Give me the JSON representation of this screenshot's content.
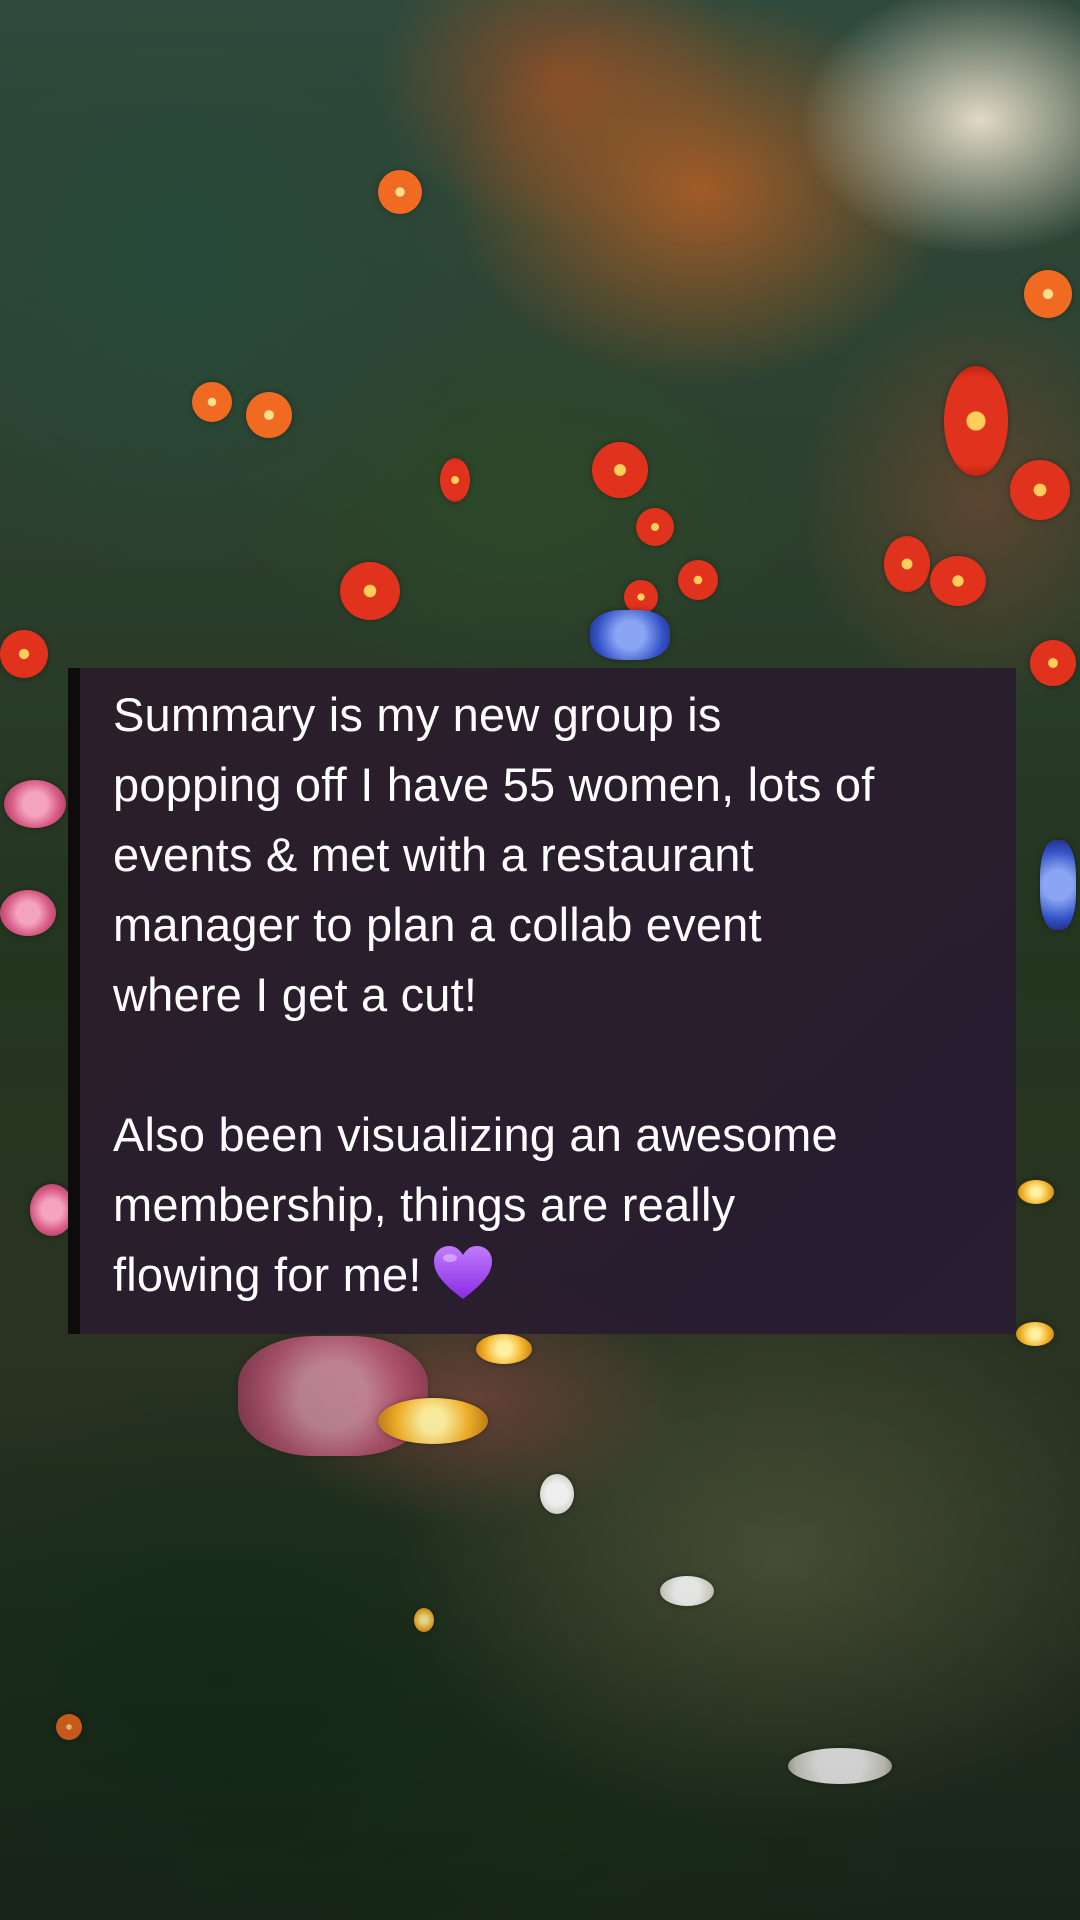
{
  "story": {
    "message_paragraph_1": "Summary is my new group is\npopping off I have 55 women, lots of\nevents & met with a restaurant\nmanager to plan a collab event\nwhere I get a cut!",
    "message_paragraph_2": "Also been visualizing an awesome\nmembership, things are really\nflowing for me!",
    "emoji": "purple-heart-icon"
  },
  "colors": {
    "card_background": "#2b1f33",
    "text": "#ffffff",
    "heart": "#a44dff"
  }
}
